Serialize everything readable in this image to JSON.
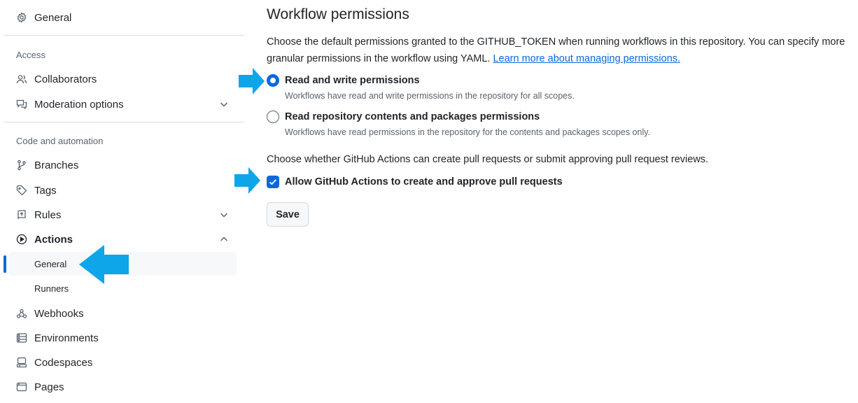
{
  "sidebar": {
    "top_item": {
      "label": "General",
      "icon": "gear-icon"
    },
    "access": {
      "heading": "Access",
      "items": [
        {
          "label": "Collaborators",
          "icon": "people-icon"
        },
        {
          "label": "Moderation options",
          "icon": "comment-discussion-icon",
          "chevron": "chevron-down-icon"
        }
      ]
    },
    "code_automation": {
      "heading": "Code and automation",
      "items": [
        {
          "label": "Branches",
          "icon": "git-branch-icon"
        },
        {
          "label": "Tags",
          "icon": "tag-icon"
        },
        {
          "label": "Rules",
          "icon": "repo-push-icon",
          "chevron": "chevron-down-icon"
        },
        {
          "label": "Actions",
          "icon": "play-icon",
          "chevron": "chevron-up-icon",
          "expanded": true
        },
        {
          "label": "Webhooks",
          "icon": "webhook-icon"
        },
        {
          "label": "Environments",
          "icon": "server-icon"
        },
        {
          "label": "Codespaces",
          "icon": "codespaces-icon"
        },
        {
          "label": "Pages",
          "icon": "browser-icon"
        }
      ],
      "actions_subitems": [
        {
          "label": "General",
          "active": true
        },
        {
          "label": "Runners",
          "active": false
        }
      ]
    }
  },
  "main": {
    "title": "Workflow permissions",
    "description": "Choose the default permissions granted to the GITHUB_TOKEN when running workflows in this repository. You can specify more granular permissions in the workflow using YAML.",
    "learn_more_link": "Learn more about managing permissions.",
    "options": [
      {
        "label": "Read and write permissions",
        "description": "Workflows have read and write permissions in the repository for all scopes.",
        "selected": true
      },
      {
        "label": "Read repository contents and packages permissions",
        "description": "Workflows have read permissions in the repository for the contents and packages scopes only.",
        "selected": false
      }
    ],
    "pr_question": "Choose whether GitHub Actions can create pull requests or submit approving pull request reviews.",
    "pr_checkbox": {
      "label": "Allow GitHub Actions to create and approve pull requests",
      "checked": true
    },
    "save_label": "Save"
  },
  "colors": {
    "accent": "#0969da",
    "annotation_arrow": "#0ea5e9",
    "muted_text": "#59636e",
    "border": "#d1d9e0"
  }
}
